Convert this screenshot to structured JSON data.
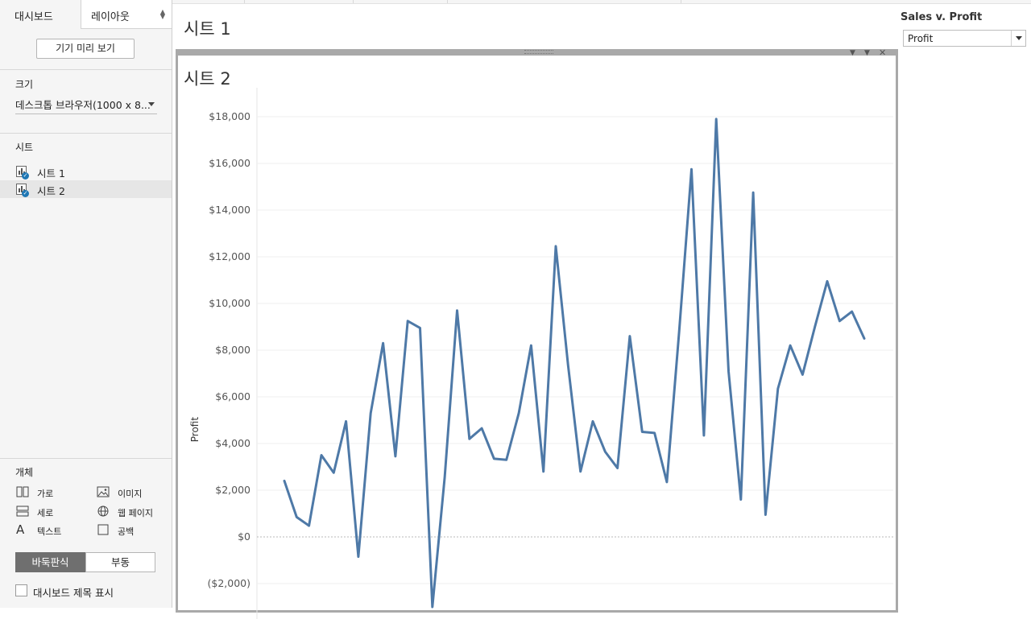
{
  "left_pane": {
    "tabs": [
      {
        "label": "대시보드",
        "active": true
      },
      {
        "label": "레이아웃",
        "active": false
      }
    ],
    "preview_button": "기기 미리 보기",
    "size_section": {
      "title": "크기",
      "selected": "데스크톱 브라우저(1000 x 8..."
    },
    "sheets_section": {
      "title": "시트",
      "items": [
        {
          "label": "시트 1",
          "selected": false
        },
        {
          "label": "시트 2",
          "selected": true
        }
      ]
    },
    "objects_section": {
      "title": "개체",
      "items": [
        {
          "label": "가로",
          "icon": "horizontal-container-icon"
        },
        {
          "label": "이미지",
          "icon": "image-icon"
        },
        {
          "label": "세로",
          "icon": "vertical-container-icon"
        },
        {
          "label": "웹 페이지",
          "icon": "globe-icon"
        },
        {
          "label": "텍스트",
          "icon": "text-icon"
        },
        {
          "label": "공백",
          "icon": "blank-icon"
        }
      ]
    },
    "layout_toggle": {
      "on": "바둑판식",
      "off": "부동"
    },
    "show_title_checkbox": {
      "label": "대시보드 제목 표시",
      "checked": false
    }
  },
  "dashboard": {
    "title": "시트 1",
    "sheet_title": "시트 2"
  },
  "filter": {
    "title": "Sales v. Profit",
    "value": "Profit"
  },
  "chart_data": {
    "type": "line",
    "title": "시트 2",
    "ylabel": "Profit",
    "xlabel": "",
    "color": "#4e79a7",
    "ylim": [
      -3000,
      18500
    ],
    "yticks": [
      -2000,
      0,
      2000,
      4000,
      6000,
      8000,
      10000,
      12000,
      14000,
      16000,
      18000
    ],
    "ytick_labels": [
      "($2,000)",
      "$0",
      "$2,000",
      "$4,000",
      "$6,000",
      "$8,000",
      "$10,000",
      "$12,000",
      "$14,000",
      "$16,000",
      "$18,000"
    ],
    "grid": true,
    "series": [
      {
        "name": "",
        "values": [
          2400,
          850,
          480,
          3500,
          2750,
          4950,
          -850,
          5300,
          8300,
          3450,
          9250,
          8950,
          -3000,
          2550,
          9700,
          4200,
          4650,
          3350,
          3300,
          5300,
          8200,
          2800,
          12450,
          7350,
          2800,
          4950,
          3650,
          2950,
          8600,
          4500,
          4450,
          2350,
          8800,
          15750,
          4350,
          17900,
          7100,
          1600,
          14750,
          950,
          6350,
          8200,
          6950,
          9000,
          10950,
          9250,
          9650,
          8500
        ]
      }
    ]
  }
}
